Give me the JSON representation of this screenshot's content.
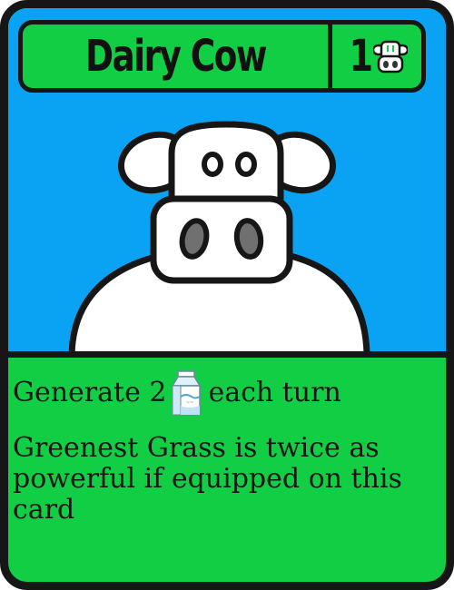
{
  "card": {
    "name": "Dairy Cow",
    "cost": "1",
    "cost_icon": "cow-face-icon",
    "art_icon": "cow-illustration",
    "colors": {
      "frame": "#12ce45",
      "art_background": "#0aa3f3",
      "border": "#161616"
    }
  },
  "abilities": {
    "generate_prefix": "Generate 2",
    "generate_icon": "milk-carton-icon",
    "generate_suffix": "each turn",
    "text": "Greenest Grass is twice as powerful if equipped on this card"
  }
}
